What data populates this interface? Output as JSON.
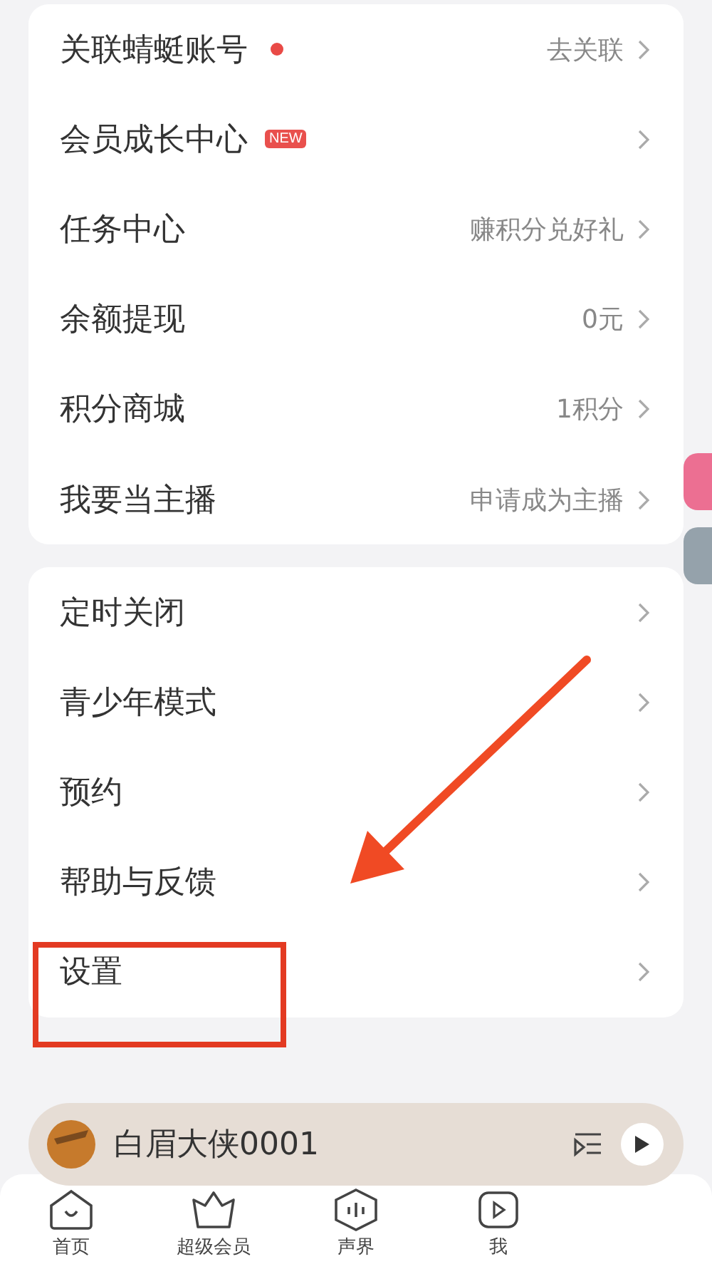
{
  "menu_groups": [
    {
      "items": [
        {
          "label": "关联蜻蜓账号",
          "marker": {
            "kind": "dot"
          },
          "value": "去关联"
        },
        {
          "label": "会员成长中心",
          "marker": {
            "kind": "new",
            "text": "NEW"
          }
        },
        {
          "label": "任务中心",
          "value": "赚积分兑好礼"
        },
        {
          "label": "余额提现",
          "value": "0元"
        },
        {
          "label": "积分商城",
          "value": "1积分"
        },
        {
          "label": "我要当主播",
          "value": "申请成为主播"
        }
      ]
    },
    {
      "items": [
        {
          "label": "定时关闭"
        },
        {
          "label": "青少年模式"
        },
        {
          "label": "预约"
        },
        {
          "label": "帮助与反馈"
        },
        {
          "label": "设置"
        }
      ]
    }
  ],
  "player": {
    "title": "白眉大侠0001"
  },
  "tab_bar": [
    {
      "label": "首页",
      "kind": "home"
    },
    {
      "label": "超级会员",
      "kind": "vip"
    },
    {
      "label": "声界",
      "kind": "sound"
    },
    {
      "label": "我",
      "kind": "mine"
    }
  ]
}
